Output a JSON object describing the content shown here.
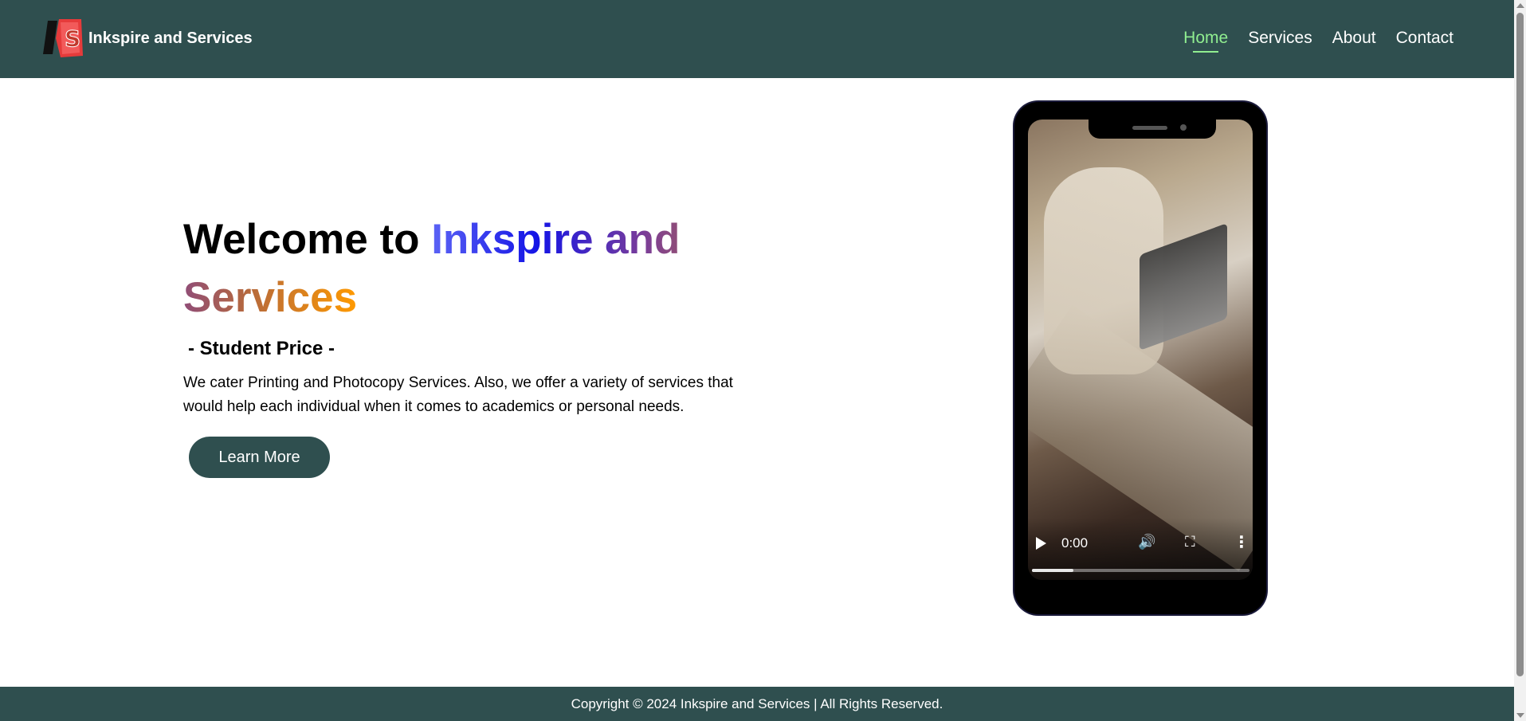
{
  "header": {
    "brand": "Inkspire and Services",
    "logo_text": "IS",
    "nav": [
      {
        "label": "Home",
        "active": true
      },
      {
        "label": "Services",
        "active": false
      },
      {
        "label": "About",
        "active": false
      },
      {
        "label": "Contact",
        "active": false
      }
    ]
  },
  "hero": {
    "title_prefix": "Welcome to ",
    "title_highlight": "Inkspire and Services",
    "subtitle": "- Student Price -",
    "description": "We cater Printing and Photocopy Services. Also, we offer a variety of services that would help each individual when it comes to academics or personal needs.",
    "button_label": "Learn More"
  },
  "video": {
    "time": "0:00",
    "progress": 0.19,
    "icons": [
      "play-icon",
      "volume-icon",
      "fullscreen-icon",
      "more-options-icon"
    ]
  },
  "footer": {
    "copyright": "Copyright © 2024 Inkspire and Services | All Rights Reserved."
  },
  "colors": {
    "header_bg": "#2f4f4f",
    "nav_active": "#90ee90",
    "button_bg": "#2f4f4f"
  }
}
